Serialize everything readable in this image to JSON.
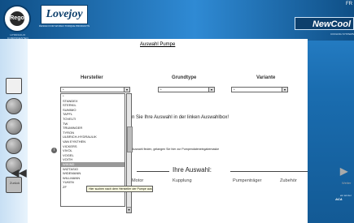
{
  "header": {
    "logo_letter": "Rego",
    "logo_subtitle": "HYDRAULIK KOMPONENTEN",
    "lovejoy": "Lovejoy",
    "lovejoy_subtitle": "DESIGN FOR WORLD TORQUE PRODUCTS",
    "newcool": "NewCool",
    "newcool_subtitle": "COOLING SYSTEMS",
    "lang": "FR"
  },
  "page": {
    "title": "Auswahl Pumpe"
  },
  "filters": {
    "hersteller_label": "Hersteller",
    "grundtype_label": "Grundtype",
    "variante_label": "Variante",
    "hersteller_value": "*",
    "grundtype_value": "*",
    "variante_value": "*"
  },
  "list": {
    "items": [
      "*",
      "STANDEX",
      "STERKIL",
      "SUMIMO",
      "TAPFL",
      "TOVELTI",
      "TW",
      "TRUMINGER",
      "TYRON",
      "ULBRICH-HYDRAULIK",
      "VAN EYNTHEN",
      "VICKERS",
      "VIVOL",
      "VOGEL",
      "VOITH",
      "WIKIND",
      "WIZTASIO",
      "WIDEMANN",
      "WILLMANN",
      "YUKEN",
      "ZF"
    ],
    "selected_index": 15
  },
  "instructions": {
    "main": "n Sie Ihre Auswahl in der linken Auswahlbox!",
    "hint": "Auswahl finden, gelangen Sie hier zur Pumpendateneingabemaske",
    "tooltip": "Hier suchen nach dem Hersteller der Pumpe aus"
  },
  "navigation": {
    "back_label": "Zurück",
    "forward_label": "Weiter",
    "ihre_auswahl": "Ihre Auswahl:",
    "options": [
      "Motor",
      "Kupplung",
      "Pumpenträger",
      "Zubehör"
    ]
  },
  "footer": {
    "brand": "ACA",
    "brand_sub": "ein teil der"
  }
}
